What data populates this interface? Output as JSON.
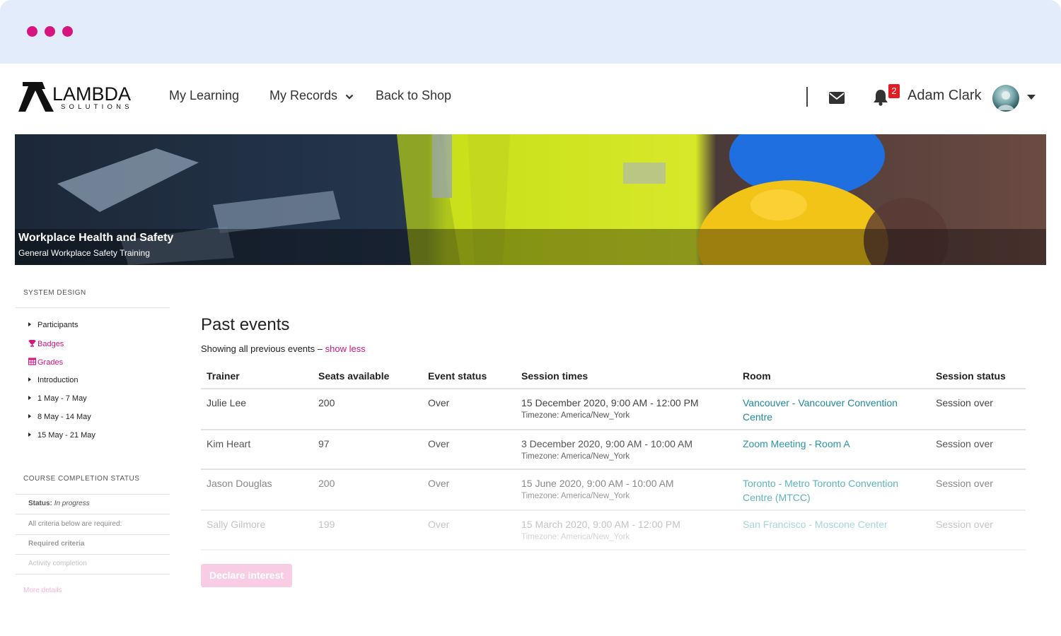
{
  "window": {
    "accent": "#d6157f",
    "chrome_color": "#e2ecfb"
  },
  "brand": {
    "word": "LAMBDA",
    "sub": "SOLUTIONS"
  },
  "nav": {
    "my_learning": "My Learning",
    "my_records": "My Records",
    "back_to_shop": "Back to Shop",
    "notification_count": "2",
    "user_name": "Adam Clark"
  },
  "banner": {
    "title": "Workplace Health and Safety",
    "subtitle": "General Workplace Safety Training"
  },
  "sidebar": {
    "section_title": "SYSTEM DESIGN",
    "items": [
      {
        "label": "Participants",
        "icon": "triangle-right-icon"
      },
      {
        "label": "Badges",
        "icon": "trophy-icon"
      },
      {
        "label": "Grades",
        "icon": "table-icon"
      },
      {
        "label": "Introduction",
        "icon": "triangle-right-icon"
      },
      {
        "label": "1 May - 7 May",
        "icon": "triangle-right-icon"
      },
      {
        "label": "8 May - 14 May",
        "icon": "triangle-right-icon"
      },
      {
        "label": "15 May - 21 May",
        "icon": "triangle-right-icon"
      }
    ],
    "completion": {
      "title": "COURSE COMPLETION STATUS",
      "status_label": "Status:",
      "status_value": "In progress",
      "criteria_note": "All criteria below are required:",
      "required": "Required criteria",
      "activity": "Activity completion",
      "more": "More details"
    }
  },
  "main": {
    "title": "Past events",
    "showing": "Showing all previous events –",
    "show_less": "show less",
    "columns": [
      "Trainer",
      "Seats available",
      "Event status",
      "Session times",
      "Room",
      "Session status"
    ],
    "rows": [
      {
        "trainer": "Julie Lee",
        "seats": "200",
        "event_status": "Over",
        "time": "15 December 2020, 9:00 AM - 12:00 PM",
        "tz": "Timezone: America/New_York",
        "room": "Vancouver - Vancouver Convention Centre",
        "session_status": "Session over"
      },
      {
        "trainer": "Kim Heart",
        "seats": "97",
        "event_status": "Over",
        "time": "3 December 2020, 9:00 AM - 10:00 AM",
        "tz": "Timezone: America/New_York",
        "room": "Zoom Meeting - Room A",
        "session_status": "Session over"
      },
      {
        "trainer": "Jason Douglas",
        "seats": "200",
        "event_status": "Over",
        "time": "15 June 2020, 9:00 AM - 10:00 AM",
        "tz": "Timezone: America/New_York",
        "room": "Toronto - Metro Toronto Convention Centre (MTCC)",
        "session_status": "Session over"
      },
      {
        "trainer": "Sally Gilmore",
        "seats": "199",
        "event_status": "Over",
        "time": "15 March 2020, 9:00 AM - 12:00 PM",
        "tz": "Timezone: America/New_York",
        "room": "San Francisco - Moscone Center",
        "session_status": "Session over"
      }
    ],
    "declare_button": "Declare interest"
  }
}
